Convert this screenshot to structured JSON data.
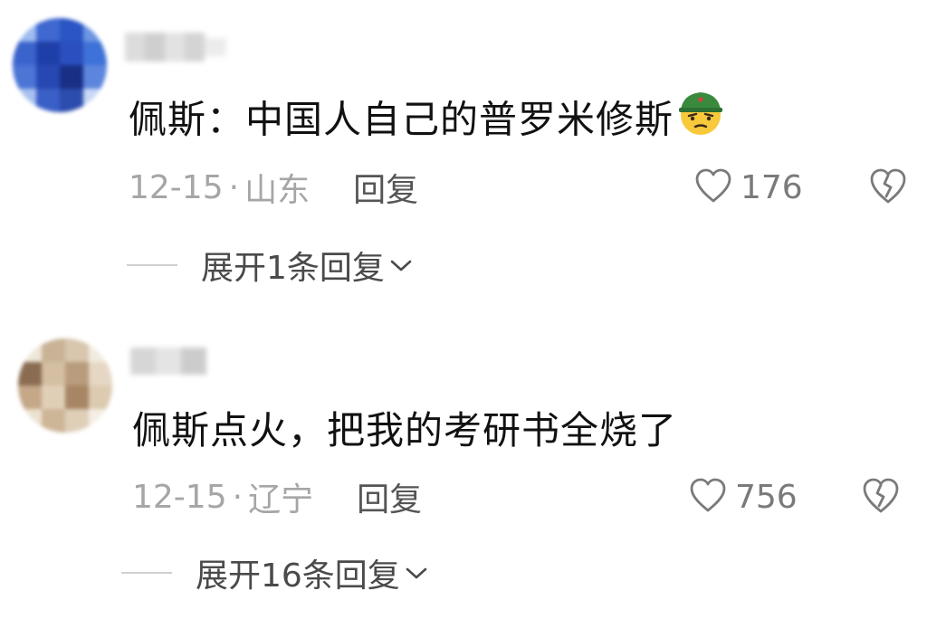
{
  "comments": [
    {
      "text": "佩斯：中国人自己的普罗米修斯",
      "emoji": "soldier-helmet-emoji",
      "date": "12-15",
      "dot": "·",
      "location": "山东",
      "reply_label": "回复",
      "like_count": "176",
      "expand_label": "展开1条回复"
    },
    {
      "text": "佩斯点火，把我的考研书全烧了",
      "date": "12-15",
      "dot": "·",
      "location": "辽宁",
      "reply_label": "回复",
      "like_count": "756",
      "expand_label": "展开16条回复"
    }
  ],
  "icons": {
    "like": "heart-outline-icon",
    "dislike": "broken-heart-icon",
    "expand": "chevron-down-icon"
  },
  "colors": {
    "text": "#111111",
    "meta": "#a6a6a6",
    "icon": "#7a7a7a"
  }
}
